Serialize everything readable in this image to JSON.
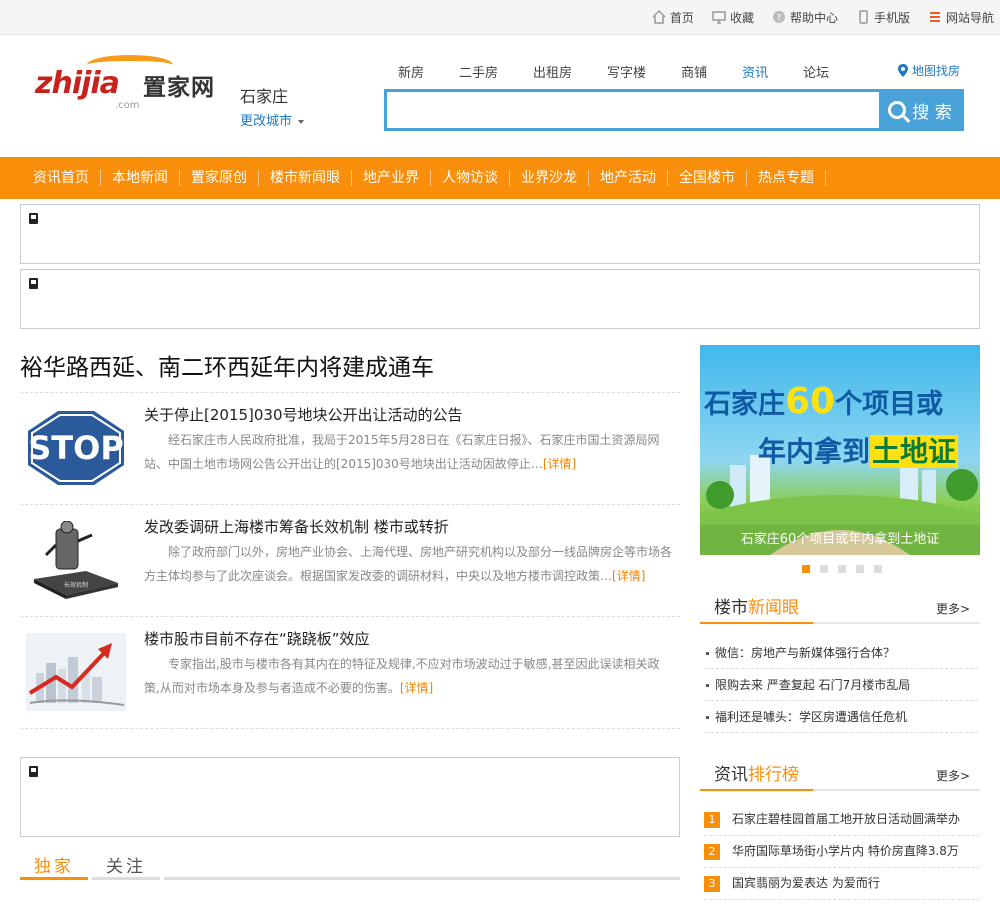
{
  "topbar": {
    "links": [
      {
        "icon": "home-icon",
        "label": "首页"
      },
      {
        "icon": "monitor-icon",
        "label": "收藏"
      },
      {
        "icon": "help-icon",
        "label": "帮助中心"
      },
      {
        "icon": "phone-icon",
        "label": "手机版"
      },
      {
        "icon": "menu-icon",
        "label": "网站导航"
      }
    ]
  },
  "logo": {
    "en": "zhijia",
    "cn": "置家网",
    "domain": ".com"
  },
  "city": {
    "name": "石家庄",
    "change": "更改城市"
  },
  "nav_tabs": [
    {
      "label": "新房",
      "active": false
    },
    {
      "label": "二手房",
      "active": false
    },
    {
      "label": "出租房",
      "active": false
    },
    {
      "label": "写字楼",
      "active": false
    },
    {
      "label": "商铺",
      "active": false
    },
    {
      "label": "资讯",
      "active": true
    },
    {
      "label": "论坛",
      "active": false
    }
  ],
  "map_find": "地图找房",
  "search": {
    "value": "",
    "button": "搜 索"
  },
  "main_nav": [
    "资讯首页",
    "本地新闻",
    "置家原创",
    "楼市新闻眼",
    "地产业界",
    "人物访谈",
    "业界沙龙",
    "地产活动",
    "全国楼市",
    "热点专题"
  ],
  "headline": "裕华路西延、南二环西延年内将建成通车",
  "news": [
    {
      "thumb": "stop-sign-image",
      "title": "关于停止[2015]030号地块公开出让活动的公告",
      "desc": "经石家庄市人民政府批准，我局于2015年5月28日在《石家庄日报》、石家庄市国土资源局网站、中国土地市场网公告公开出让的[2015]030号地块出让活动因故停止…",
      "more": "[详情]"
    },
    {
      "thumb": "mechanism-figure-image",
      "title": "发改委调研上海楼市筹备长效机制 楼市或转折",
      "desc": "除了政府部门以外，房地产业协会、上海代理、房地产研究机构以及部分一线品牌房企等市场各方主体均参与了此次座谈会。根据国家发改委的调研材料，中央以及地方楼市调控政策…",
      "more": "[详情]"
    },
    {
      "thumb": "city-trend-image",
      "title": "楼市股市目前不存在“跷跷板”效应",
      "desc": "专家指出,股市与楼市各有其内在的特征及规律,不应对市场波动过于敏感,甚至因此误读相关政策,从而对市场本身及参与者造成不必要的伤害。",
      "more": "[详情]"
    }
  ],
  "tabs_bottom": [
    "独家",
    "关注"
  ],
  "banner": {
    "line1_pre": "石家庄",
    "line1_num": "60",
    "line1_post": "个项目或",
    "line2_pre": "年内拿到",
    "line2_hl": "土地证",
    "caption": "石家庄60个项目或年内拿到土地证"
  },
  "slider_dots": 5,
  "section_news_eye": {
    "title_plain": "楼市",
    "title_accent": "新闻眼",
    "more": "更多>"
  },
  "news_eye_items": [
    "微信：房地产与新媒体强行合体？",
    "限购去来 严查复起 石门7月楼市乱局",
    "福利还是噱头：学区房遭遇信任危机"
  ],
  "section_rank": {
    "title_plain": "资讯",
    "title_accent": "排行榜",
    "more": "更多>"
  },
  "rank_items": [
    {
      "n": "1",
      "text": "石家庄碧桂园首届工地开放日活动圆满举办"
    },
    {
      "n": "2",
      "text": "华府国际草场街小学片内 特价房直降3.8万"
    },
    {
      "n": "3",
      "text": "国宾翡丽为爱表达 为爱而行"
    }
  ],
  "colors": {
    "accent": "#f98e0a",
    "link": "#1e78c2",
    "search_border": "#4aa3d8"
  }
}
